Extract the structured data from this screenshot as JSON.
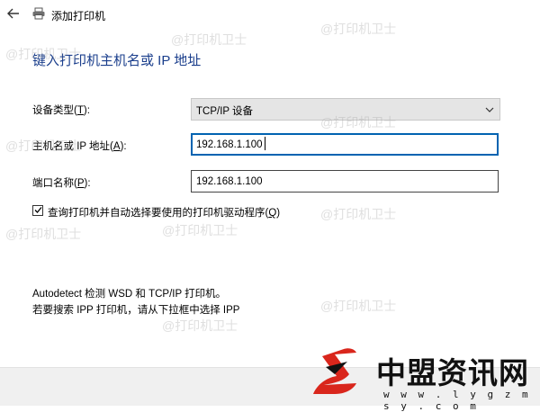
{
  "window": {
    "title": "添加打印机"
  },
  "heading": "键入打印机主机名或 IP 地址",
  "form": {
    "device_type": {
      "label_pre": "设备类型(",
      "label_key": "T",
      "label_post": "):",
      "value": "TCP/IP 设备"
    },
    "hostname": {
      "label_pre": "主机名或 IP 地址(",
      "label_key": "A",
      "label_post": "):",
      "value": "192.168.1.100"
    },
    "port": {
      "label_pre": "端口名称(",
      "label_key": "P",
      "label_post": "):",
      "value": "192.168.1.100"
    },
    "auto_driver": {
      "checked": true,
      "label_pre": "查询打印机并自动选择要使用的打印机驱动程序(",
      "label_key": "Q",
      "label_post": ")"
    }
  },
  "info": {
    "line1": "Autodetect 检测 WSD 和 TCP/IP 打印机。",
    "line2": "若要搜索 IPP 打印机，请从下拉框中选择 IPP"
  },
  "watermark": {
    "text": "@打印机卫士"
  },
  "brand": {
    "name": "中盟资讯网",
    "url": "w w w . l y g z m s y . c o m"
  },
  "icons": {
    "back": "back-arrow-icon",
    "printer": "printer-icon",
    "chevron": "chevron-down-icon",
    "check": "checkmark-icon"
  },
  "colors": {
    "heading": "#1a3e8c",
    "focus_border": "#0063b1",
    "dropdown_bg": "#e5e5e5",
    "footer_bg": "#f0f0f0",
    "logo_red": "#d9261c"
  }
}
